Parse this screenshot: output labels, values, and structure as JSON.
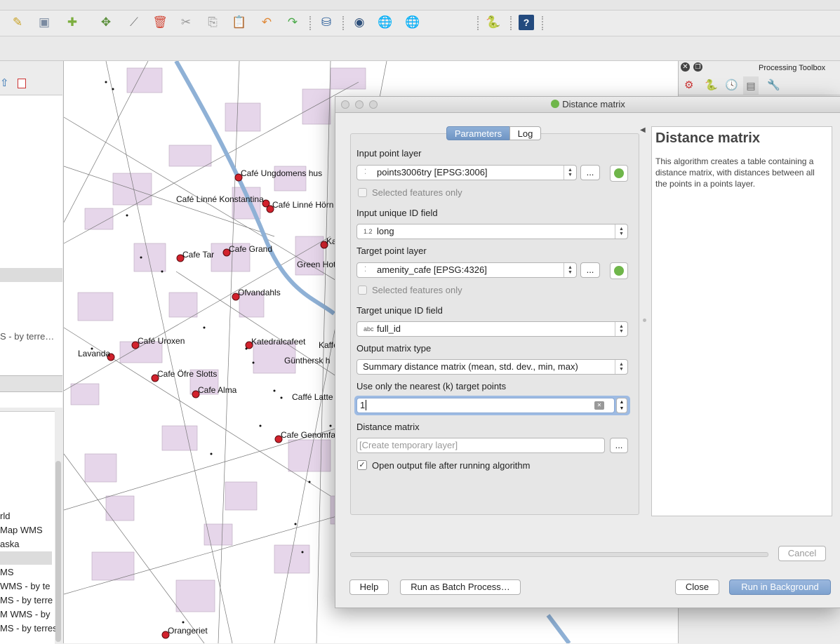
{
  "dialog": {
    "title": "Distance matrix",
    "tabs": [
      {
        "label": "Parameters",
        "active": true
      },
      {
        "label": "Log",
        "active": false
      }
    ],
    "params": {
      "input_point_layer_label": "Input point layer",
      "input_point_layer_value": "points3006try [EPSG:3006]",
      "selected_only_label": "Selected features only",
      "input_id_label": "Input unique ID field",
      "input_id_type": "1.2",
      "input_id_value": "long",
      "target_layer_label": "Target point layer",
      "target_layer_value": "amenity_cafe [EPSG:4326]",
      "target_selected_only_label": "Selected features only",
      "target_id_label": "Target unique ID field",
      "target_id_type": "abc",
      "target_id_value": "full_id",
      "matrix_type_label": "Output matrix type",
      "matrix_type_value": "Summary distance matrix (mean, std. dev., min, max)",
      "nearest_k_label": "Use only the nearest (k) target points",
      "nearest_k_value": "1",
      "distance_matrix_label": "Distance matrix",
      "distance_matrix_placeholder": "[Create temporary layer]",
      "open_output_label": "Open output file after running algorithm",
      "open_output_checked": true,
      "browse_label": "..."
    },
    "help": {
      "title": "Distance matrix",
      "text": "This algorithm creates a table containing a distance matrix, with distances between all the points in a points layer."
    },
    "buttons": {
      "cancel": "Cancel",
      "help": "Help",
      "batch": "Run as Batch Process…",
      "close": "Close",
      "run": "Run in Background"
    }
  },
  "toolbox": {
    "title": "Processing Toolbox"
  },
  "left_panel": {
    "items": [
      "S - by terre…",
      "rld",
      "Map WMS",
      "aska",
      "MS",
      "WMS - by te",
      "MS - by terre",
      "M WMS - by",
      "MS - by terres"
    ]
  },
  "map": {
    "labels": [
      "Café Ungdomens hus",
      "Café Linné Konstantina",
      "Café Linné Hörn",
      "Cafe Tar",
      "Cafe Grand",
      "Green Hot",
      "Ofvandahls",
      "Café Uroxen",
      "Lavanda",
      "Katedralcafeet",
      "Kaffe",
      "Günthersk h",
      "Cafe Öfre Slotts",
      "Cafe Alma",
      "Caffé Latte",
      "Cafe Genomfa",
      "Orangeriet",
      "Ka"
    ]
  },
  "colors": {
    "accent": "#6f95c4",
    "cafe_marker": "#d2222d",
    "block": "#e6d6ea",
    "water": "#8fb1d6"
  }
}
